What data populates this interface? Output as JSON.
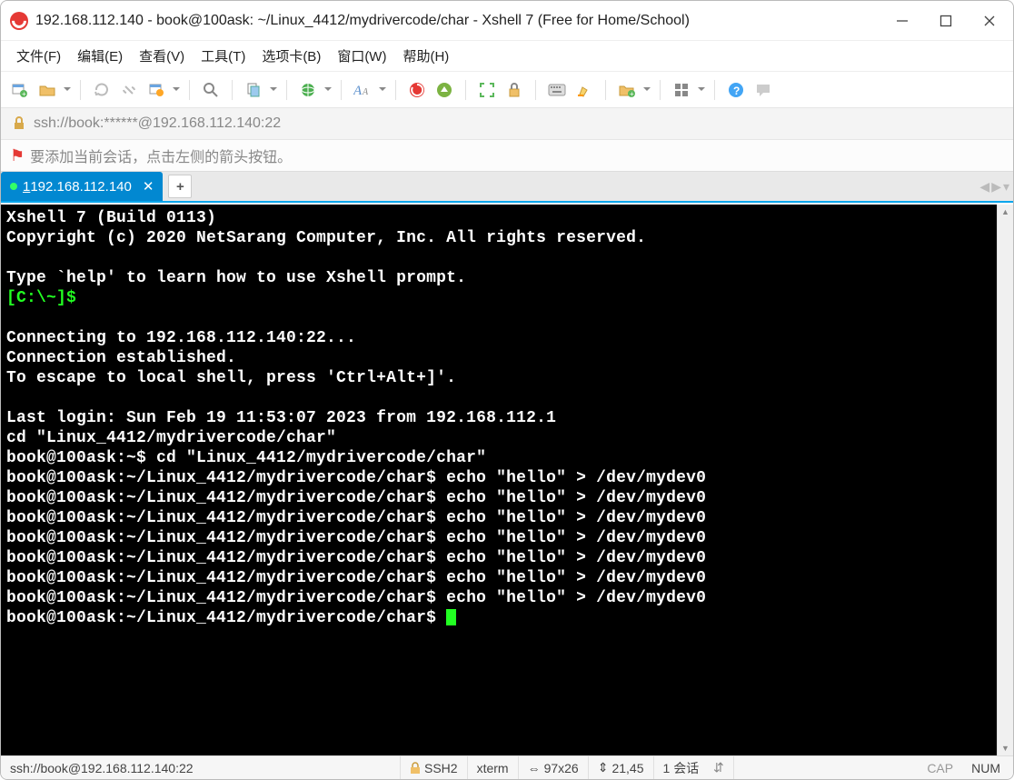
{
  "window": {
    "title": "192.168.112.140 - book@100ask: ~/Linux_4412/mydrivercode/char - Xshell 7 (Free for Home/School)"
  },
  "menu": {
    "file": "文件(F)",
    "edit": "编辑(E)",
    "view": "查看(V)",
    "tools": "工具(T)",
    "tabs": "选项卡(B)",
    "window": "窗口(W)",
    "help": "帮助(H)"
  },
  "address": {
    "url": "ssh://book:******@192.168.112.140:22"
  },
  "hint": {
    "text": "要添加当前会话，点击左侧的箭头按钮。"
  },
  "tab": {
    "index": "1",
    "label": " 192.168.112.140",
    "newtab": "+"
  },
  "terminal": {
    "line1": "Xshell 7 (Build 0113)",
    "line2": "Copyright (c) 2020 NetSarang Computer, Inc. All rights reserved.",
    "line4": "Type `help' to learn how to use Xshell prompt.",
    "prompt_local": "[C:\\~]$",
    "line7": "Connecting to 192.168.112.140:22...",
    "line8": "Connection established.",
    "line9": "To escape to local shell, press 'Ctrl+Alt+]'.",
    "line11": "Last login: Sun Feb 19 11:53:07 2023 from 192.168.112.1",
    "line12": "cd \"Linux_4412/mydrivercode/char\"",
    "prompt_home": "book@100ask:~$ ",
    "cmd_cd": "cd \"Linux_4412/mydrivercode/char\"",
    "prompt_char": "book@100ask:~/Linux_4412/mydrivercode/char$ ",
    "cmd_echo": "echo \"hello\" > /dev/mydev0"
  },
  "status": {
    "addr": "ssh://book@192.168.112.140:22",
    "proto": "SSH2",
    "term": "xterm",
    "size_icon": "⇔",
    "size": "97x26",
    "pos_icon": "⇕",
    "pos": "21,45",
    "sessions": "1 会话",
    "sessions_arrows": "⇵",
    "cap": "CAP",
    "num": "NUM"
  }
}
